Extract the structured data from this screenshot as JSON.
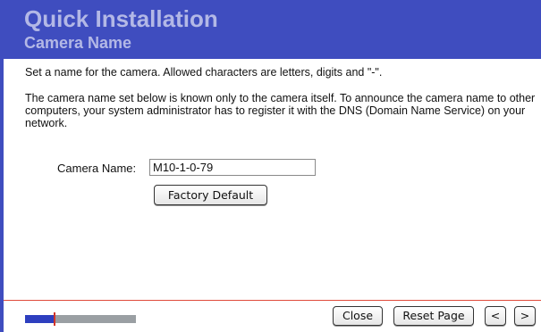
{
  "header": {
    "title": "Quick Installation",
    "subtitle": "Camera Name"
  },
  "content": {
    "instruction": "Set a name for the camera. Allowed characters are letters, digits and \"-\".",
    "dns_note": "The camera name set below is known only to the camera itself. To announce the camera name to other computers, your system administrator has to register it with the DNS (Domain Name Service) on your network."
  },
  "form": {
    "camera_name_label": "Camera Name:",
    "camera_name_value": "M10-1-0-79",
    "factory_default_label": "Factory Default"
  },
  "footer": {
    "progress_fraction": 0.27,
    "close_label": "Close",
    "reset_label": "Reset Page",
    "prev_label": "<",
    "next_label": ">"
  },
  "colors": {
    "header_bg": "#3f4dbf",
    "header_text": "#b3b8e6",
    "separator": "#e04a3a",
    "progress_fill": "#2e3fbf",
    "progress_track": "#9a9fa3",
    "progress_marker": "#d2342a"
  }
}
